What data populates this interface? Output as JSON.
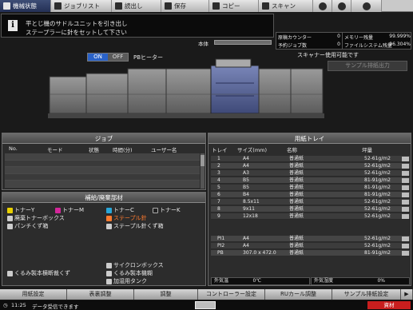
{
  "tabs": [
    {
      "label": "機械状態",
      "active": true
    },
    {
      "label": "ジョブリスト",
      "active": false
    },
    {
      "label": "読出し",
      "active": false
    },
    {
      "label": "保存",
      "active": false
    },
    {
      "label": "コピー",
      "active": false
    },
    {
      "label": "スキャン",
      "active": false
    }
  ],
  "message": {
    "line1": "平とじ機のサドルユニットを引き出し",
    "line2": "ステープラーに針をセットして下さい"
  },
  "body_label": "本体",
  "counters": {
    "total_label": "原稿カウンター",
    "total_value": "0",
    "memory_label": "メモリー残量",
    "memory_value": "99.999%",
    "reserve_label": "予約ジョブ数",
    "reserve_value": "0",
    "filesys_label": "ファイルシステム残量",
    "filesys_value": "96.304%"
  },
  "scanner_status": "スキャナー使用可能です",
  "sample_button": "サンプル排紙出力",
  "heater": {
    "on_label": "ON",
    "off_label": "OFF",
    "label": "PBヒーター",
    "state": "ON"
  },
  "job_panel": {
    "title": "ジョブ",
    "columns": [
      "No.",
      "モード",
      "状態",
      "時間(分)",
      "ユーザー名"
    ]
  },
  "supply_panel": {
    "title": "補給/廃棄部材",
    "items": [
      {
        "label": "トナーY",
        "color": "#e8d000"
      },
      {
        "label": "トナーM",
        "color": "#d4269a"
      },
      {
        "label": "トナーC",
        "color": "#2aa6d8"
      },
      {
        "label": "トナーK",
        "color": "#222222"
      },
      {
        "label": "廃棄トナーボックス",
        "color": "#cccccc"
      },
      {
        "label": "ステープル針",
        "color": "#ff7a2e",
        "warn": true
      },
      {
        "label": "パンチくず箱",
        "color": "#cccccc"
      },
      {
        "label": "ステープル針くず箱",
        "color": "#cccccc"
      },
      {
        "label": "サイクロンボックス",
        "color": "#cccccc"
      },
      {
        "label": "くるみ製本横断裁くず",
        "color": "#cccccc"
      },
      {
        "label": "くるみ製本機糊",
        "color": "#cccccc"
      },
      {
        "label": "加湿用タンク",
        "color": "#cccccc"
      }
    ]
  },
  "tray_panel": {
    "title": "用紙トレイ",
    "columns": [
      "トレイ",
      "サイズ(mm)",
      "名称",
      "坪量"
    ],
    "rows": [
      {
        "tray": "1",
        "size": "A4",
        "name": "普通紙",
        "weight": "52-61g/m2"
      },
      {
        "tray": "2",
        "size": "A4",
        "name": "普通紙",
        "weight": "52-61g/m2"
      },
      {
        "tray": "3",
        "size": "A3",
        "name": "普通紙",
        "weight": "52-61g/m2"
      },
      {
        "tray": "4",
        "size": "B5",
        "name": "普通紙",
        "weight": "81-91g/m2"
      },
      {
        "tray": "5",
        "size": "B5",
        "name": "普通紙",
        "weight": "81-91g/m2"
      },
      {
        "tray": "6",
        "size": "B4",
        "name": "普通紙",
        "weight": "81-91g/m2"
      },
      {
        "tray": "7",
        "size": "8.5x11",
        "name": "普通紙",
        "weight": "52-61g/m2"
      },
      {
        "tray": "8",
        "size": "9x11",
        "name": "普通紙",
        "weight": "52-61g/m2"
      },
      {
        "tray": "9",
        "size": "12x18",
        "name": "普通紙",
        "weight": "52-61g/m2"
      },
      {
        "tray": "PI1",
        "size": "A4",
        "name": "普通紙",
        "weight": "52-61g/m2"
      },
      {
        "tray": "PI2",
        "size": "A4",
        "name": "普通紙",
        "weight": "52-61g/m2"
      },
      {
        "tray": "PB",
        "size": "307.0 x 472.0",
        "name": "普通紙",
        "weight": "81-91g/m2"
      }
    ],
    "outside_temp_label": "外気温",
    "outside_temp_value": "0℃",
    "outside_humid_label": "外気湿度",
    "outside_humid_value": "0%"
  },
  "bottom_nav": [
    "用紙設定",
    "表裏調整",
    "調整",
    "コントローラー設定",
    "RUカール調整",
    "サンプル排紙設定"
  ],
  "status": {
    "time": "11:25",
    "message": "データ受信できます",
    "alert": "資材"
  }
}
